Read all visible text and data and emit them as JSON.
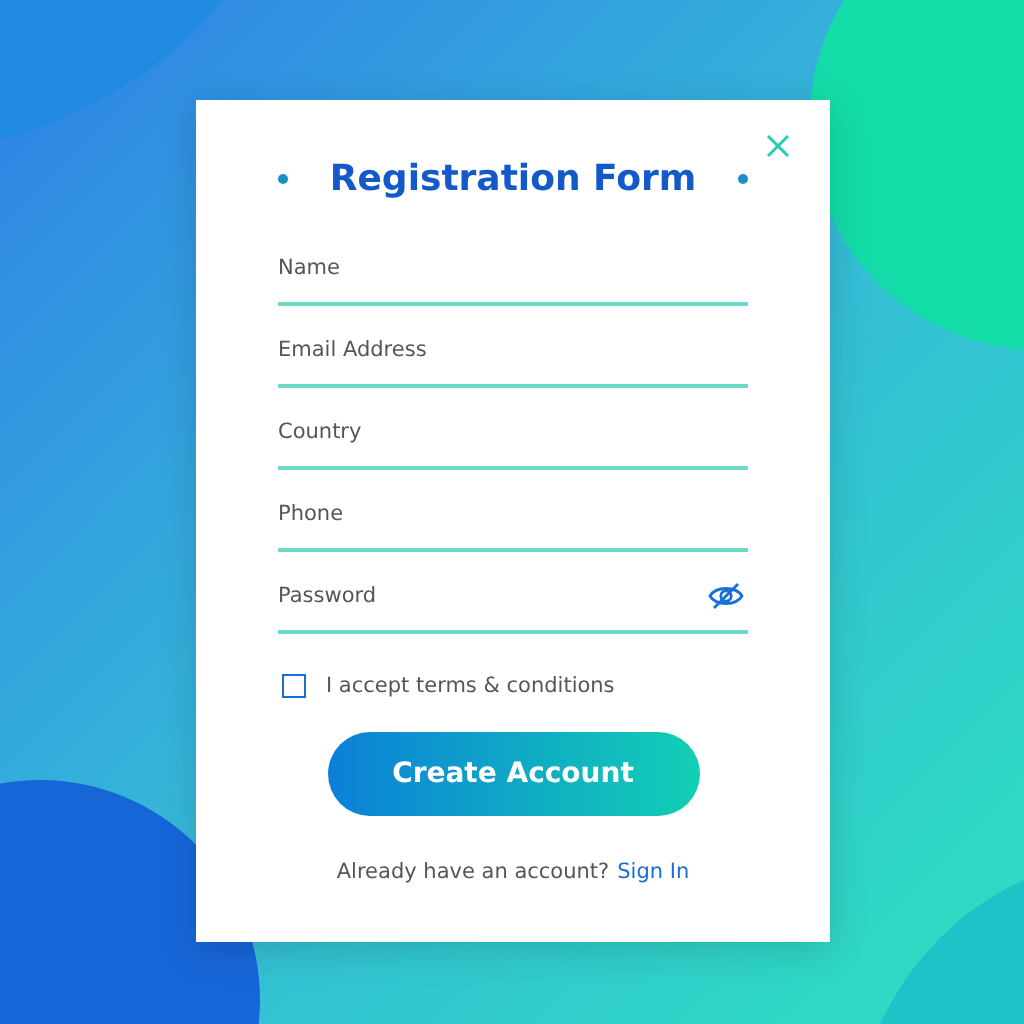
{
  "title": "Registration Form",
  "fields": [
    {
      "placeholder": "Name",
      "kind": "text"
    },
    {
      "placeholder": "Email Address",
      "kind": "text"
    },
    {
      "placeholder": "Country",
      "kind": "text"
    },
    {
      "placeholder": "Phone",
      "kind": "text"
    },
    {
      "placeholder": "Password",
      "kind": "password"
    }
  ],
  "terms": {
    "label": "I accept terms & conditions",
    "checked": false
  },
  "submit": "Create Account",
  "footer": {
    "text": "Already have an account?",
    "link": "Sign In"
  }
}
